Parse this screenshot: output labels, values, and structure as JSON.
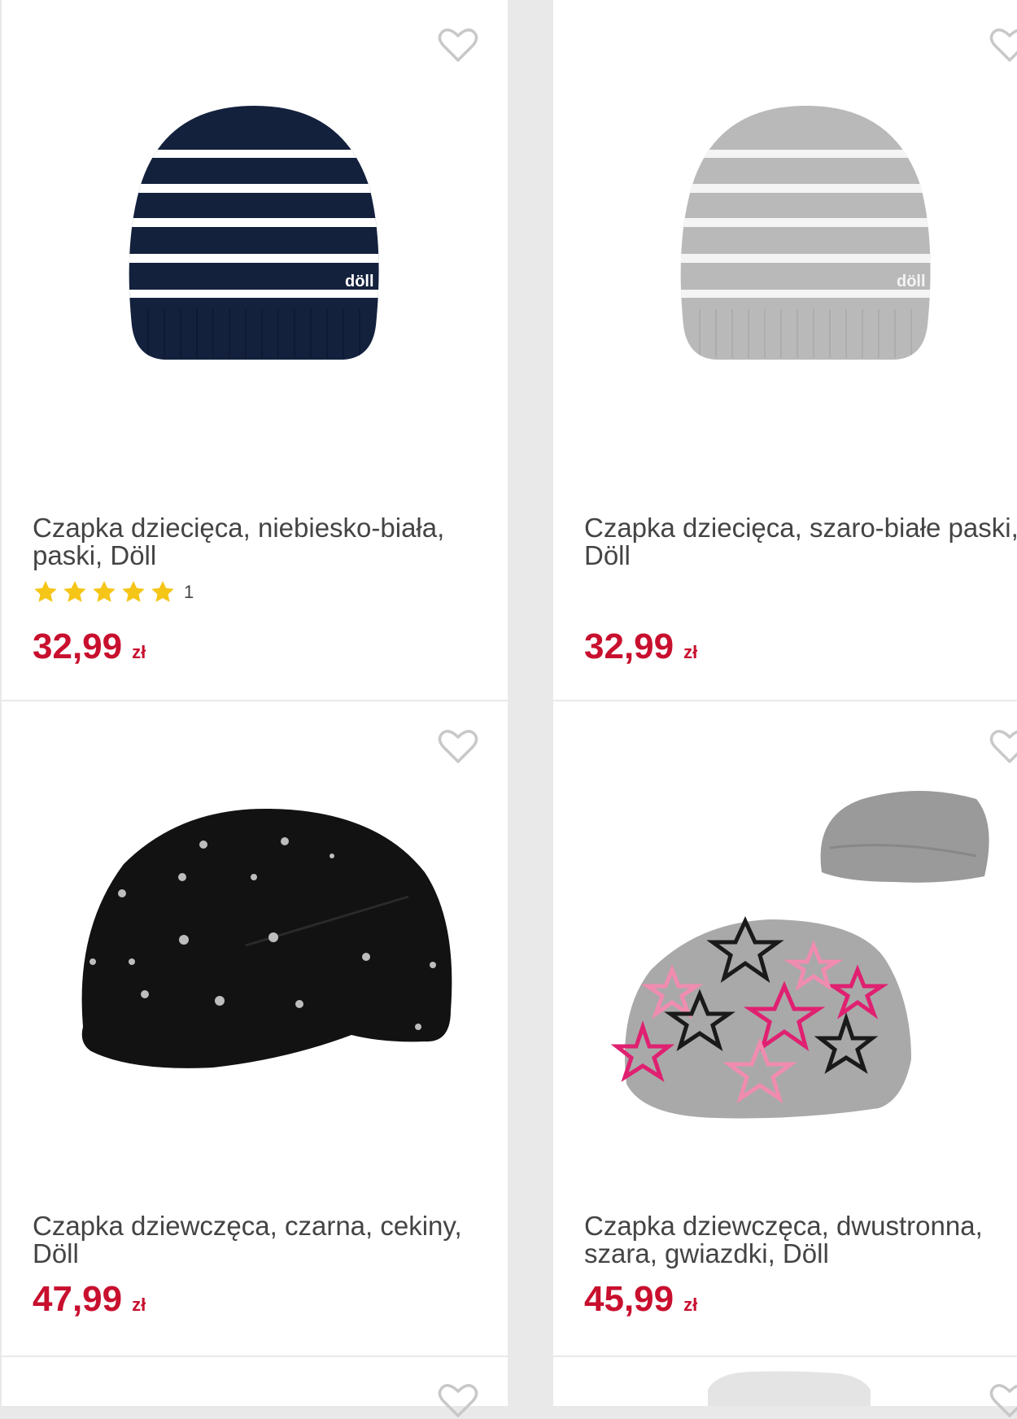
{
  "products": [
    {
      "title": "Czapka dziecięca, niebiesko-biała, paski, Döll",
      "price": "32,99",
      "currency": "zł",
      "rating_count": "1",
      "logo": "döll"
    },
    {
      "title": "Czapka dziecięca, szaro-białe paski, Döll",
      "price": "32,99",
      "currency": "zł",
      "logo": "döll"
    },
    {
      "title": "Czapka dziewczęca, czarna, cekiny, Döll",
      "price": "47,99",
      "currency": "zł"
    },
    {
      "title": "Czapka dziewczęca, dwustronna, szara, gwiazdki, Döll",
      "price": "45,99",
      "currency": "zł"
    }
  ],
  "colors": {
    "price": "#c8102e",
    "star": "#f5c518",
    "heart_outline": "#c8c8c8",
    "title": "#444444"
  },
  "icons": {
    "favorite": "heart-outline-icon",
    "rating": "star-icon"
  },
  "rating": {
    "value": 5,
    "max": 5
  }
}
